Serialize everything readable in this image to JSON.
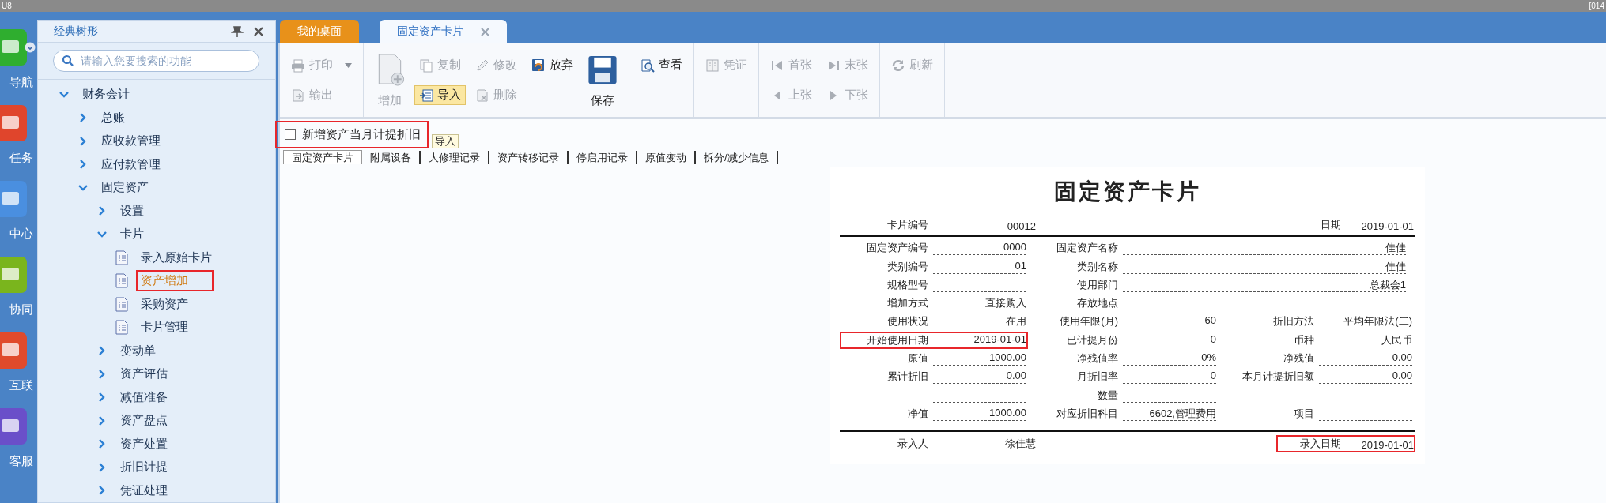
{
  "title_bar": {
    "left_text": "U8",
    "right_text": "[014"
  },
  "nav_strip": [
    {
      "label": "导航",
      "color": "#2fae2f",
      "has_menu": true
    },
    {
      "label": "任务",
      "color": "#e0452c",
      "has_menu": false
    },
    {
      "label": "中心",
      "color": "#4a8fe0",
      "has_menu": false
    },
    {
      "label": "协同",
      "color": "#7ab51d",
      "has_menu": false
    },
    {
      "label": "互联",
      "color": "#e04a2c",
      "has_menu": false
    },
    {
      "label": "客服",
      "color": "#6a4fc9",
      "has_menu": false
    }
  ],
  "sidebar": {
    "title": "经典树形",
    "search": {
      "placeholder": "请输入您要搜索的功能"
    },
    "tree": [
      {
        "label": "财务会计",
        "kind": "folder",
        "expanded": true,
        "selected": false,
        "highlighted": false,
        "children": [
          {
            "label": "总账",
            "kind": "folder",
            "expanded": false,
            "selected": false,
            "highlighted": false
          },
          {
            "label": "应收款管理",
            "kind": "folder",
            "expanded": false,
            "selected": false,
            "highlighted": false
          },
          {
            "label": "应付款管理",
            "kind": "folder",
            "expanded": false,
            "selected": false,
            "highlighted": false
          },
          {
            "label": "固定资产",
            "kind": "folder",
            "expanded": true,
            "selected": false,
            "highlighted": false,
            "children": [
              {
                "label": "设置",
                "kind": "folder",
                "expanded": false,
                "selected": false,
                "highlighted": false
              },
              {
                "label": "卡片",
                "kind": "folder",
                "expanded": true,
                "selected": false,
                "highlighted": false,
                "children": [
                  {
                    "label": "录入原始卡片",
                    "kind": "leaf",
                    "selected": false,
                    "highlighted": false
                  },
                  {
                    "label": "资产增加",
                    "kind": "leaf",
                    "selected": true,
                    "highlighted": true
                  },
                  {
                    "label": "采购资产",
                    "kind": "leaf",
                    "selected": false,
                    "highlighted": false
                  },
                  {
                    "label": "卡片管理",
                    "kind": "leaf",
                    "selected": false,
                    "highlighted": false
                  }
                ]
              },
              {
                "label": "变动单",
                "kind": "folder",
                "expanded": false,
                "selected": false,
                "highlighted": false
              },
              {
                "label": "资产评估",
                "kind": "folder",
                "expanded": false,
                "selected": false,
                "highlighted": false
              },
              {
                "label": "减值准备",
                "kind": "folder",
                "expanded": false,
                "selected": false,
                "highlighted": false
              },
              {
                "label": "资产盘点",
                "kind": "folder",
                "expanded": false,
                "selected": false,
                "highlighted": false
              },
              {
                "label": "资产处置",
                "kind": "folder",
                "expanded": false,
                "selected": false,
                "highlighted": false
              },
              {
                "label": "折旧计提",
                "kind": "folder",
                "expanded": false,
                "selected": false,
                "highlighted": false
              },
              {
                "label": "凭证处理",
                "kind": "folder",
                "expanded": false,
                "selected": false,
                "highlighted": false
              }
            ]
          }
        ]
      }
    ]
  },
  "tabs": [
    {
      "label": "我的桌面",
      "kind": "home",
      "selected": false,
      "closable": false
    },
    {
      "label": "固定资产卡片",
      "kind": "document",
      "selected": true,
      "closable": true
    }
  ],
  "toolbar": [
    {
      "items": [
        {
          "label": "打印",
          "kind": "small",
          "disabled": true,
          "hovered": false,
          "has_menu": true
        },
        {
          "label": "输出",
          "kind": "small",
          "disabled": true,
          "hovered": false,
          "has_menu": false
        }
      ]
    },
    {
      "items": [
        {
          "label": "增加",
          "kind": "big",
          "disabled": true,
          "hovered": false,
          "has_menu": false
        },
        {
          "label": "复制",
          "kind": "small",
          "disabled": true,
          "hovered": false,
          "has_menu": false
        },
        {
          "label": "导入",
          "kind": "small",
          "disabled": false,
          "hovered": true,
          "has_menu": false
        },
        {
          "label": "修改",
          "kind": "small",
          "disabled": true,
          "hovered": false,
          "has_menu": false
        },
        {
          "label": "删除",
          "kind": "small",
          "disabled": true,
          "hovered": false,
          "has_menu": false
        },
        {
          "label": "放弃",
          "kind": "small",
          "disabled": false,
          "hovered": false,
          "has_menu": false
        },
        {
          "label": "保存",
          "kind": "big",
          "disabled": false,
          "hovered": false,
          "has_menu": false
        }
      ]
    },
    {
      "items": [
        {
          "label": "查看",
          "kind": "small",
          "disabled": false,
          "hovered": false,
          "has_menu": false
        }
      ]
    },
    {
      "items": [
        {
          "label": "凭证",
          "kind": "small",
          "disabled": true,
          "hovered": false,
          "has_menu": false
        }
      ]
    },
    {
      "items": [
        {
          "label": "首张",
          "kind": "small",
          "disabled": true,
          "hovered": false,
          "has_menu": false
        },
        {
          "label": "上张",
          "kind": "small",
          "disabled": true,
          "hovered": false,
          "has_menu": false
        },
        {
          "label": "末张",
          "kind": "small",
          "disabled": true,
          "hovered": false,
          "has_menu": false
        },
        {
          "label": "下张",
          "kind": "small",
          "disabled": true,
          "hovered": false,
          "has_menu": false
        }
      ]
    },
    {
      "items": [
        {
          "label": "刷新",
          "kind": "small",
          "disabled": true,
          "hovered": false,
          "has_menu": false
        }
      ]
    }
  ],
  "option": {
    "label": "新增资产当月计提折旧",
    "checked": false,
    "highlighted": true
  },
  "tooltip": {
    "text": "导入"
  },
  "subtabs": [
    {
      "label": "固定资产卡片",
      "selected": true
    },
    {
      "label": "附属设备",
      "selected": false
    },
    {
      "label": "大修理记录",
      "selected": false
    },
    {
      "label": "资产转移记录",
      "selected": false
    },
    {
      "label": "停启用记录",
      "selected": false
    },
    {
      "label": "原值变动",
      "selected": false
    },
    {
      "label": "拆分/减少信息",
      "selected": false
    }
  ],
  "card": {
    "title": "固定资产卡片",
    "header": [
      {
        "label": "卡片编号",
        "value": "00012",
        "highlighted": false
      },
      {
        "label": "日期",
        "value": "2019-01-01",
        "highlighted": false
      }
    ],
    "rows": [
      [
        {
          "label": "固定资产编号",
          "value": "0000",
          "kind": "normal",
          "highlighted": false
        },
        {
          "label": "固定资产名称",
          "value": "佳佳",
          "kind": "wide",
          "highlighted": false
        }
      ],
      [
        {
          "label": "类别编号",
          "value": "01",
          "kind": "normal",
          "highlighted": false
        },
        {
          "label": "类别名称",
          "value": "佳佳",
          "kind": "wide",
          "highlighted": false
        }
      ],
      [
        {
          "label": "规格型号",
          "kind": "normal",
          "highlighted": false
        },
        {
          "label": "使用部门",
          "value": "总裁会1",
          "kind": "wide",
          "highlighted": false
        }
      ],
      [
        {
          "label": "增加方式",
          "value": "直接购入",
          "kind": "normal",
          "highlighted": false
        },
        {
          "label": "存放地点",
          "kind": "wide",
          "highlighted": false
        }
      ],
      [
        {
          "label": "使用状况",
          "value": "在用",
          "kind": "normal",
          "highlighted": false
        },
        {
          "label": "使用年限(月)",
          "value": "60",
          "kind": "normal",
          "highlighted": false
        },
        {
          "label": "折旧方法",
          "value": "平均年限法(二)",
          "kind": "normal",
          "highlighted": false
        }
      ],
      [
        {
          "label": "开始使用日期",
          "value": "2019-01-01",
          "kind": "normal",
          "highlighted": true
        },
        {
          "label": "已计提月份",
          "value": "0",
          "kind": "normal",
          "highlighted": false
        },
        {
          "label": "币种",
          "value": "人民币",
          "kind": "normal",
          "highlighted": false
        }
      ],
      [
        {
          "label": "原值",
          "value": "1000.00",
          "kind": "normal",
          "highlighted": false
        },
        {
          "label": "净残值率",
          "value": "0%",
          "kind": "normal",
          "highlighted": false
        },
        {
          "label": "净残值",
          "value": "0.00",
          "kind": "normal",
          "highlighted": false
        }
      ],
      [
        {
          "label": "累计折旧",
          "value": "0.00",
          "kind": "normal",
          "highlighted": false
        },
        {
          "label": "月折旧率",
          "value": "0",
          "kind": "normal",
          "highlighted": false
        },
        {
          "label": "本月计提折旧额",
          "value": "0.00",
          "kind": "normal",
          "highlighted": false
        }
      ],
      [
        {
          "kind": "normal",
          "highlighted": false
        },
        {
          "label": "数量",
          "kind": "normal",
          "highlighted": false
        }
      ],
      [
        {
          "label": "净值",
          "value": "1000.00",
          "kind": "normal",
          "highlighted": false
        },
        {
          "label": "对应折旧科目",
          "value": "6602,管理费用",
          "kind": "normal",
          "highlighted": false
        },
        {
          "label": "项目",
          "kind": "normal",
          "highlighted": false
        }
      ]
    ],
    "footer": [
      {
        "label": "录入人",
        "value": "徐佳慧",
        "highlighted": false
      },
      {
        "label": "录入日期",
        "value": "2019-01-01",
        "highlighted": true
      }
    ]
  }
}
